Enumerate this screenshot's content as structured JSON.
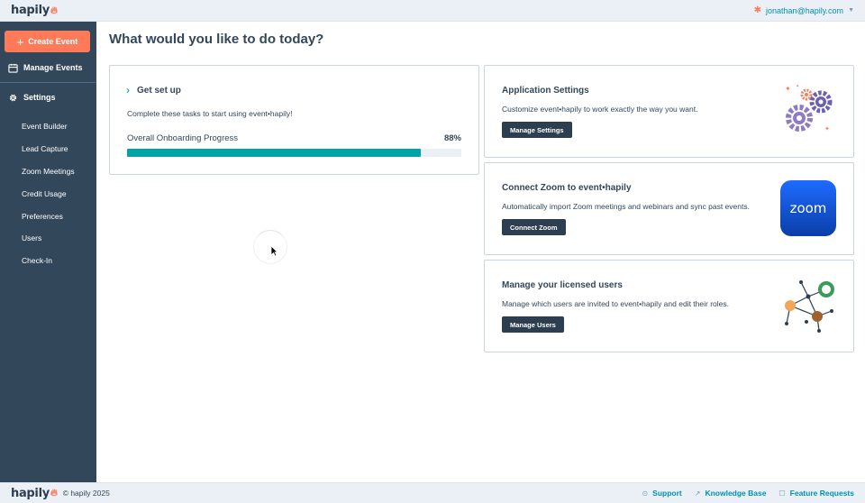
{
  "header": {
    "logo": "hapily",
    "user_email": "jonathan@hapily.com"
  },
  "sidebar": {
    "create_button": "Create Event",
    "manage_events": "Manage Events",
    "settings": "Settings",
    "items": [
      {
        "label": "Event Builder"
      },
      {
        "label": "Lead Capture"
      },
      {
        "label": "Zoom Meetings"
      },
      {
        "label": "Credit Usage"
      },
      {
        "label": "Preferences"
      },
      {
        "label": "Users"
      },
      {
        "label": "Check-In"
      }
    ]
  },
  "main": {
    "title": "What would you like to do today?",
    "setup": {
      "heading": "Get set up",
      "description": "Complete these tasks to start using event•hapily!",
      "progress_label": "Overall Onboarding Progress",
      "progress_text": "88%",
      "progress_value": 0.88
    },
    "cards": [
      {
        "title": "Application Settings",
        "description": "Customize event•hapily to work exactly the way you want.",
        "button": "Manage Settings",
        "icon": "gears-icon"
      },
      {
        "title": "Connect Zoom to event•hapily",
        "description": "Automatically import Zoom meetings and webinars and sync past events.",
        "button": "Connect Zoom",
        "icon": "zoom-logo",
        "logo_text": "zoom"
      },
      {
        "title": "Manage your licensed users",
        "description": "Manage which users are invited to event•hapily and edit their roles.",
        "button": "Manage Users",
        "icon": "users-network-icon"
      }
    ]
  },
  "footer": {
    "logo": "hapily",
    "copyright": "© hapily 2025",
    "links": [
      {
        "label": "Support",
        "icon": "help-icon"
      },
      {
        "label": "Knowledge Base",
        "icon": "external-link-icon"
      },
      {
        "label": "Feature Requests",
        "icon": "lightbulb-icon"
      }
    ]
  },
  "colors": {
    "sidebar_bg": "#33475b",
    "accent_orange": "#ff7a59",
    "progress_teal": "#00a4a6",
    "link_blue": "#0091ae",
    "button_dark": "#2d3e50"
  }
}
